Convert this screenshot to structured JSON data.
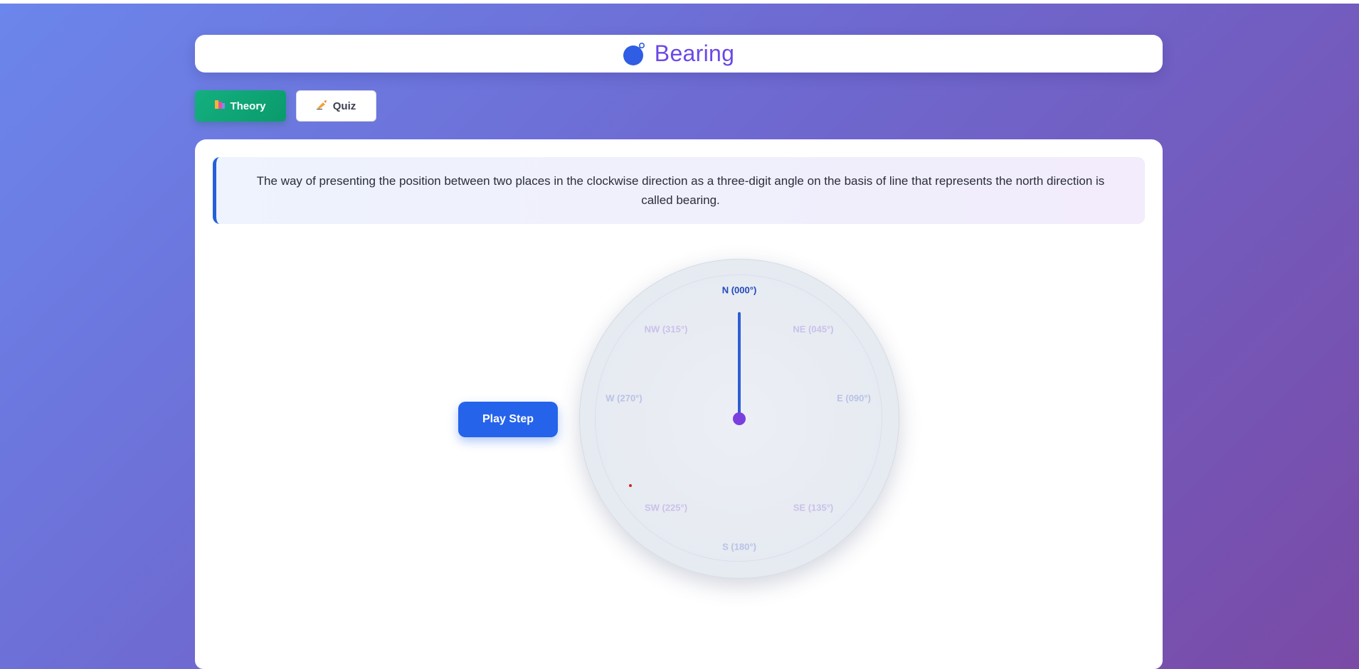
{
  "header": {
    "title": "Bearing",
    "icon": "compass-globe-icon"
  },
  "tabs": [
    {
      "label": "Theory",
      "icon": "books-icon",
      "active": true
    },
    {
      "label": "Quiz",
      "icon": "writing-hand-icon",
      "active": false
    }
  ],
  "definition": {
    "text": "The way of presenting the position between two places in the clockwise direction as a three-digit angle on the basis of line that represents the north direction is called bearing."
  },
  "controls": {
    "play_label": "Play Step"
  },
  "compass": {
    "needle_bearing_deg": 0,
    "directions": {
      "n": "N (000°)",
      "ne": "NE (045°)",
      "e": "E (090°)",
      "se": "SE (135°)",
      "s": "S (180°)",
      "sw": "SW (225°)",
      "w": "W (270°)",
      "nw": "NW (315°)"
    },
    "colors": {
      "needle": "#2c5ed6",
      "pivot": "#7b3fe0",
      "active_label": "#2249b8",
      "marker": "#d1241f"
    }
  },
  "theme": {
    "accent": "#2563eb",
    "title_color": "#6b49e6",
    "tab_active": "#0fa575"
  }
}
